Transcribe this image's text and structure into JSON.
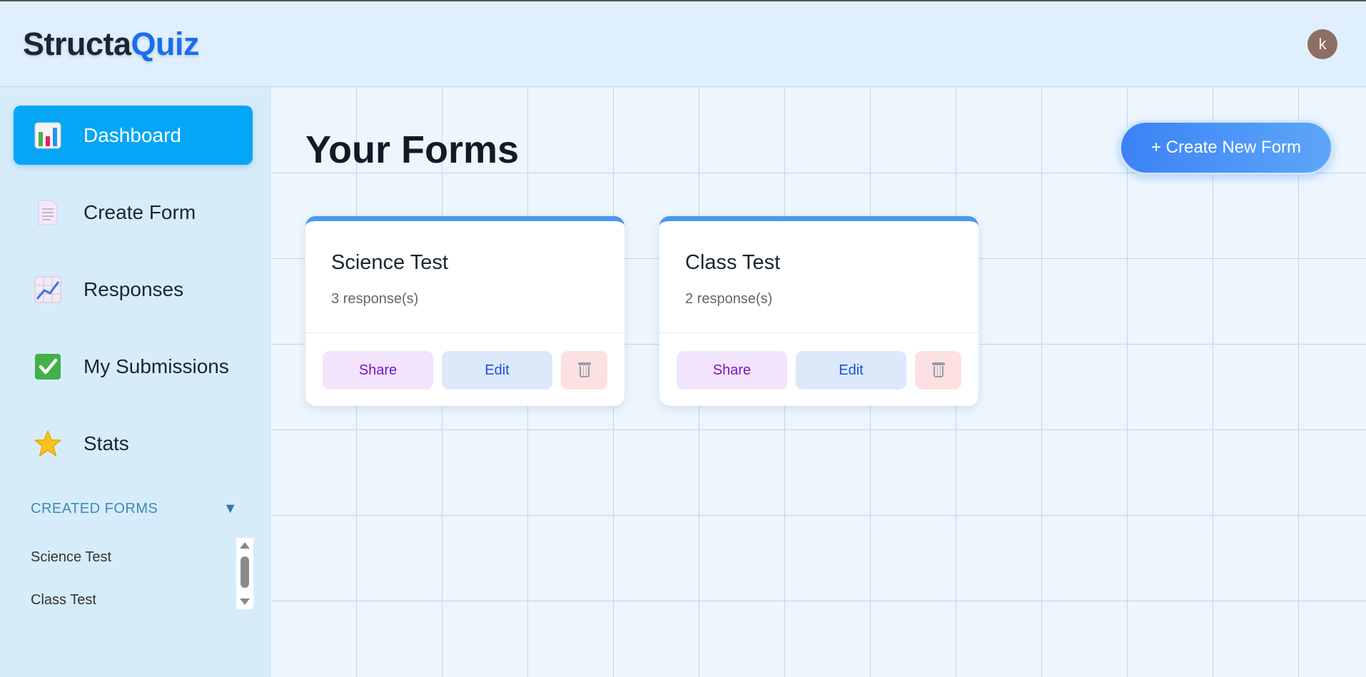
{
  "app": {
    "logo_part1": "Structa",
    "logo_part2": "Quiz",
    "avatar_letter": "k",
    "colors": {
      "brand_blue": "#1a6cf0",
      "active_nav": "#04a6f5",
      "card_accent": "#4a98f0"
    }
  },
  "sidebar": {
    "items": [
      {
        "label": "Dashboard",
        "icon": "bar-chart-icon",
        "active": true
      },
      {
        "label": "Create Form",
        "icon": "document-icon",
        "active": false
      },
      {
        "label": "Responses",
        "icon": "line-chart-icon",
        "active": false
      },
      {
        "label": "My Submissions",
        "icon": "checkmark-icon",
        "active": false
      },
      {
        "label": "Stats",
        "icon": "star-icon",
        "active": false
      }
    ],
    "section_title": "CREATED FORMS",
    "created_forms": [
      "Science Test",
      "Class Test"
    ]
  },
  "main": {
    "title": "Your Forms",
    "create_button": "+ Create New Form",
    "cards": [
      {
        "title": "Science Test",
        "count": "3 response(s)",
        "share": "Share",
        "edit": "Edit",
        "delete_icon": "trash-icon"
      },
      {
        "title": "Class Test",
        "count": "2 response(s)",
        "share": "Share",
        "edit": "Edit",
        "delete_icon": "trash-icon"
      }
    ]
  }
}
